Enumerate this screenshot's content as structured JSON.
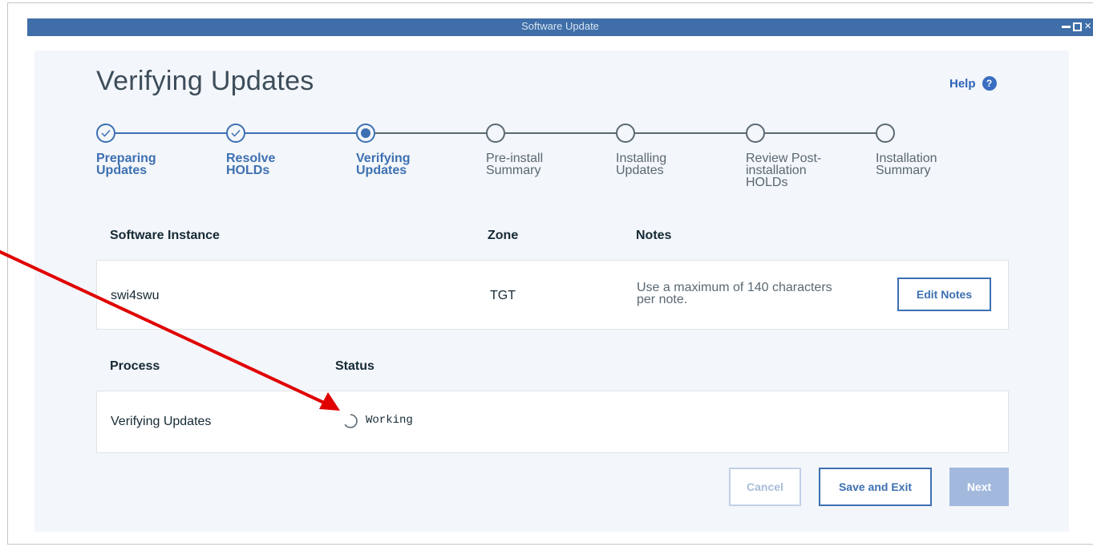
{
  "window": {
    "title": "Software Update",
    "controls": {
      "minimize": "–",
      "maximize": "□",
      "close": "×"
    }
  },
  "page": {
    "title": "Verifying Updates",
    "help_label": "Help",
    "help_icon": "?"
  },
  "stepper": {
    "current_index": 2,
    "accent": "#3d70b2",
    "steps": [
      {
        "line1": "Preparing",
        "line2": "Updates",
        "line3": "",
        "state": "done"
      },
      {
        "line1": "Resolve",
        "line2": "HOLDs",
        "line3": "",
        "state": "done"
      },
      {
        "line1": "Verifying",
        "line2": "Updates",
        "line3": "",
        "state": "current"
      },
      {
        "line1": "Pre-install",
        "line2": "Summary",
        "line3": "",
        "state": "pending"
      },
      {
        "line1": "Installing",
        "line2": "Updates",
        "line3": "",
        "state": "pending"
      },
      {
        "line1": "Review Post-",
        "line2": "installation",
        "line3": "HOLDs",
        "state": "pending"
      },
      {
        "line1": "Installation",
        "line2": "Summary",
        "line3": "",
        "state": "pending"
      }
    ]
  },
  "instance_table": {
    "headers": {
      "software_instance": "Software Instance",
      "zone": "Zone",
      "notes": "Notes"
    },
    "row": {
      "software_instance": "swi4swu",
      "zone": "TGT",
      "notes_line1": "Use a maximum of 140 characters",
      "notes_line2": "per note.",
      "edit_notes_label": "Edit Notes"
    }
  },
  "process_table": {
    "headers": {
      "process": "Process",
      "status": "Status"
    },
    "row": {
      "process": "Verifying Updates",
      "status": "Working",
      "status_icon": "spinner-icon"
    }
  },
  "footer": {
    "cancel_label": "Cancel",
    "save_exit_label": "Save and Exit",
    "next_label": "Next"
  },
  "annotation": {
    "arrow_color": "#e00000"
  }
}
